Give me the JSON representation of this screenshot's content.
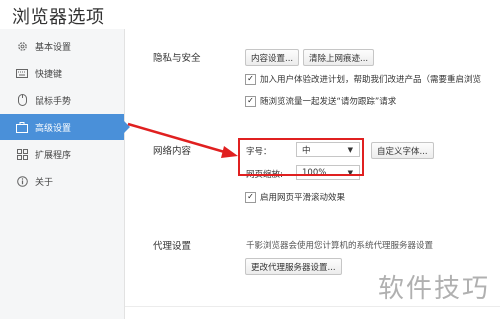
{
  "window": {
    "title": "浏览器选项"
  },
  "sidebar": {
    "items": [
      {
        "label": "基本设置",
        "icon": "gear-icon"
      },
      {
        "label": "快捷键",
        "icon": "keyboard-icon"
      },
      {
        "label": "鼠标手势",
        "icon": "mouse-icon"
      },
      {
        "label": "高级设置",
        "icon": "briefcase-icon",
        "active": true
      },
      {
        "label": "扩展程序",
        "icon": "grid-icon"
      },
      {
        "label": "关于",
        "icon": "info-icon"
      }
    ]
  },
  "privacy": {
    "section_label": "隐私与安全",
    "content_settings_button": "内容设置...",
    "clear_data_button": "清除上网痕迹...",
    "checkbox1_label": "加入用户体验改进计划，帮助我们改进产品（需要重启浏览",
    "checkbox2_label": "随浏览流量一起发送“请勿跟踪”请求"
  },
  "web_content": {
    "section_label": "网络内容",
    "font_size_label": "字号：",
    "font_size_value": "中",
    "custom_fonts_button": "自定义字体...",
    "zoom_label": "网页缩放:",
    "zoom_value": "100%",
    "smooth_scroll_label": "启用网页平滑滚动效果"
  },
  "proxy": {
    "section_label": "代理设置",
    "description": "千影浏览器会使用您计算机的系统代理服务器设置",
    "change_button": "更改代理服务器设置..."
  },
  "watermark": "软件技巧",
  "colors": {
    "accent": "#4a90d9",
    "highlight": "#e02020"
  }
}
